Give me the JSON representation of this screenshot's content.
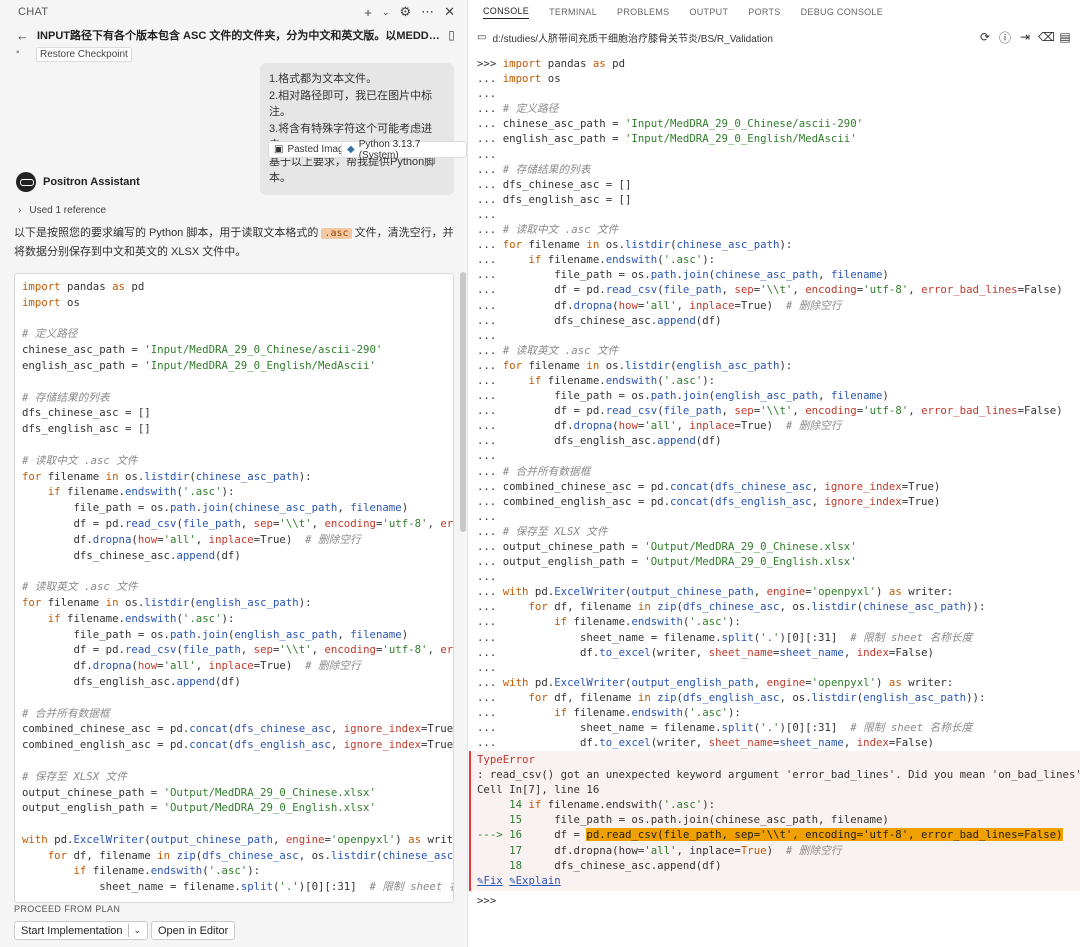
{
  "chat": {
    "panel_title": "CHAT",
    "plus_icon": "plus-icon",
    "header_title": "INPUT路径下有各个版本包含 ASC 文件的文件夹，分为中文和英文版。以MEDDRA29.0中文版和英文...",
    "restore_label": "Restore Checkpoint",
    "user_message": [
      "1.格式都为文本文件。",
      "2.相对路径即可，我已在图片中标注。",
      "3.将含有特殊字符这个可能考虑进去。",
      "基于以上要求，帮我提供Python脚本。"
    ],
    "attachment_image": "Pasted Image",
    "attachment_python": "Python 3.13.7 (System)",
    "assistant_name": "Positron Assistant",
    "reference_label": "Used 1 reference",
    "description_pre": "以下是按照您的要求编写的 Python 脚本，用于读取文本格式的 ",
    "description_code": ".asc",
    "description_post": " 文件，清洗空行，并将数据分别保存到中文和英文的 XLSX 文件中。",
    "proceed_label": "PROCEED FROM PLAN",
    "start_button": "Start Implementation",
    "open_editor_button": "Open in Editor"
  },
  "console": {
    "tabs": [
      "CONSOLE",
      "TERMINAL",
      "PROBLEMS",
      "OUTPUT",
      "PORTS",
      "DEBUG CONSOLE"
    ],
    "active_tab": "CONSOLE",
    "path": "d:/studies/人脐带间充质干细胞治疗膝骨关节炎/BS/R_Validation",
    "error_type": "TypeError",
    "error_message": ": read_csv() got an unexpected keyword argument 'error_bad_lines'. Did you mean 'on_bad_lines'?",
    "error_cell": "Cell In[7], line 16",
    "fix_link": "Fix",
    "explain_link": "Explain",
    "final_prompt": ">>>"
  },
  "colors": {
    "keyword": "#7a3ea8",
    "string": "#2f7d2a",
    "comment": "#8a8a8a",
    "function": "#2a55b5",
    "error_bg": "#faf1f1",
    "error_border": "#d93a3a",
    "highlight": "#f0a000"
  }
}
